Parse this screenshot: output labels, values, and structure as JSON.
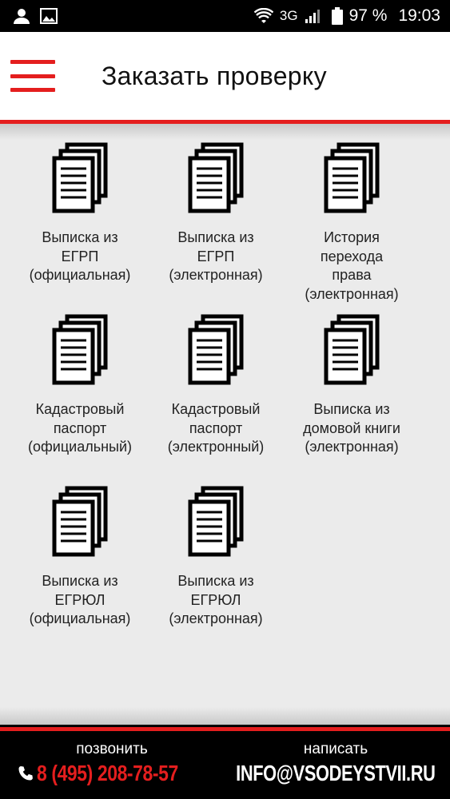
{
  "status_bar": {
    "left_icons": [
      "person-icon",
      "image-icon"
    ],
    "network": "3G",
    "battery": "97 %",
    "time": "19:03"
  },
  "header": {
    "title": "Заказать проверку",
    "accent_color": "#e41e1e"
  },
  "tiles": [
    {
      "label": "Выписка из\nЕГРП\n(официальная)"
    },
    {
      "label": "Выписка из\nЕГРП\n(электронная)"
    },
    {
      "label": "История\nперехода\nправа\n(электронная)"
    },
    {
      "label": "Кадастровый\nпаспорт\n(официальный)"
    },
    {
      "label": "Кадастровый\nпаспорт\n(электронный)"
    },
    {
      "label": "Выписка из\nдомовой книги\n(электронная)"
    },
    {
      "label": "Выписка из\nЕГРЮЛ\n(официальная)"
    },
    {
      "label": "Выписка из\nЕГРЮЛ\n(электронная)"
    }
  ],
  "footer": {
    "call_caption": "позвонить",
    "phone": "8 (495) 208-78-57",
    "write_caption": "написать",
    "email": "INFO@VSODEYSTVII.RU"
  }
}
